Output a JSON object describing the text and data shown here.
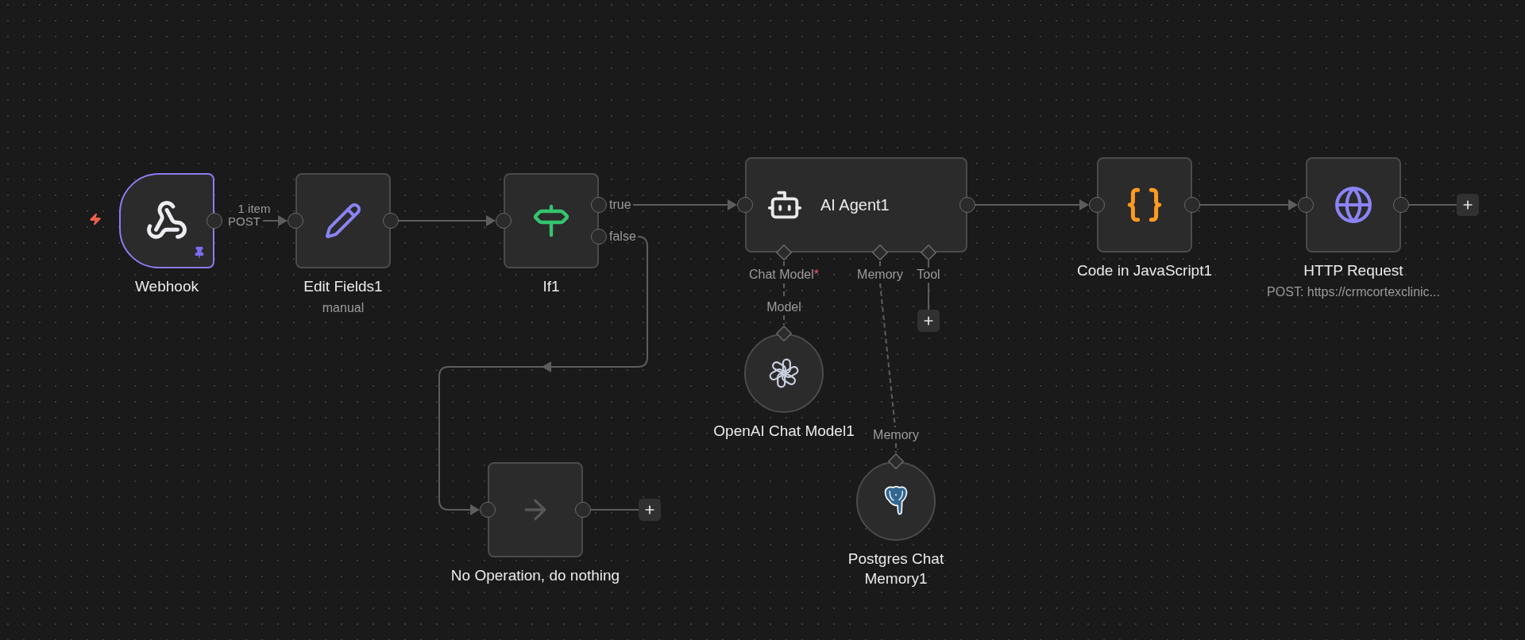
{
  "workflow": {
    "nodes": [
      {
        "kind": "trigger",
        "title": "Webhook",
        "pinned": true,
        "item_count": "1 item",
        "output_label": "POST"
      },
      {
        "kind": "action",
        "title": "Edit Fields1",
        "subtitle": "manual",
        "pinned": false
      },
      {
        "kind": "action",
        "title": "If1",
        "pinned": false,
        "outputs": [
          "true",
          "false"
        ]
      },
      {
        "kind": "agent",
        "title": "AI Agent1",
        "pinned": false,
        "sub_ports": [
          {
            "label": "Chat Model",
            "required_mark": "*"
          },
          {
            "label": "Memory"
          },
          {
            "label": "Tool",
            "add_button": true
          }
        ]
      },
      {
        "kind": "action",
        "title": "Code in JavaScript1",
        "pinned": false
      },
      {
        "kind": "action",
        "title": "HTTP Request",
        "subtitle": "POST: https://crmcortexclinic...",
        "pinned": false,
        "add_button": true
      },
      {
        "kind": "sub",
        "title": "OpenAI Chat Model1",
        "pinned": false,
        "port_label": "Model"
      },
      {
        "kind": "action",
        "title": "No Operation, do nothing",
        "pinned": false,
        "add_button": true
      },
      {
        "kind": "sub",
        "title": "Postgres Chat Memory1",
        "pinned": false,
        "port_label": "Memory"
      }
    ]
  }
}
